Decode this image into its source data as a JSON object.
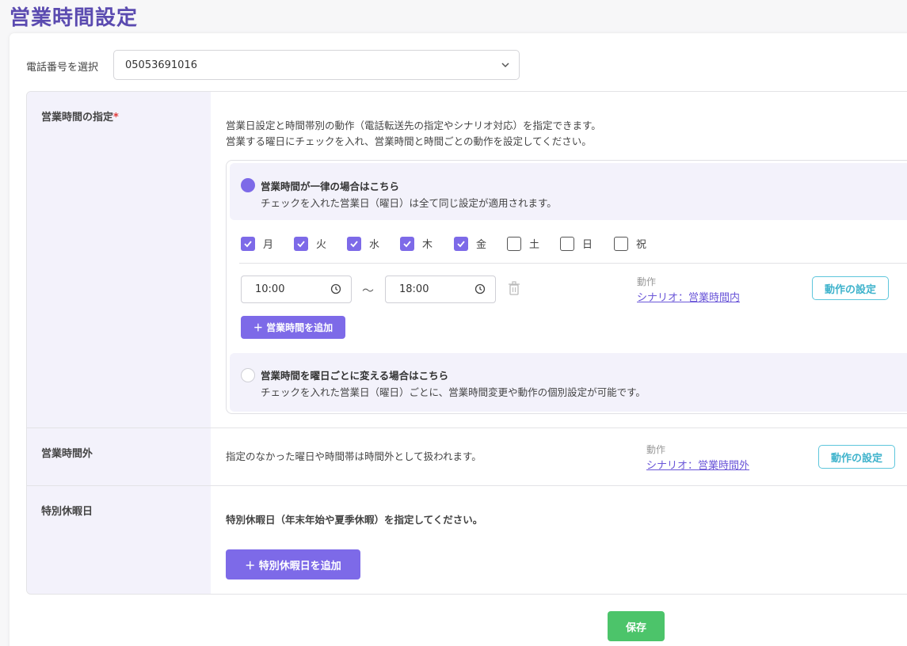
{
  "page_title": "営業時間設定",
  "phone": {
    "label": "電話番号を選択",
    "selected": "05053691016"
  },
  "business_hours": {
    "label": "営業時間の指定",
    "required_mark": "*",
    "description_line1": "営業日設定と時間帯別の動作（電話転送先の指定やシナリオ対応）を指定できます。",
    "description_line2": "営業する曜日にチェックを入れ、営業時間と時間ごとの動作を設定してください。",
    "uniform_option": {
      "title": "営業時間が一律の場合はこちら",
      "subtitle": "チェックを入れた営業日（曜日）は全て同じ設定が適用されます。",
      "selected": true
    },
    "days": [
      {
        "label": "月",
        "checked": true
      },
      {
        "label": "火",
        "checked": true
      },
      {
        "label": "水",
        "checked": true
      },
      {
        "label": "木",
        "checked": true
      },
      {
        "label": "金",
        "checked": true
      },
      {
        "label": "土",
        "checked": false
      },
      {
        "label": "日",
        "checked": false
      },
      {
        "label": "祝",
        "checked": false
      }
    ],
    "time_start": "10:00",
    "time_separator": "〜",
    "time_end": "18:00",
    "action_label": "動作",
    "action_value": "シナリオ：営業時間内",
    "action_button": "動作の設定",
    "add_time_button": "＋ 営業時間を追加",
    "per_day_option": {
      "title": "営業時間を曜日ごとに変える場合はこちら",
      "subtitle": "チェックを入れた営業日（曜日）ごとに、営業時間変更や動作の個別設定が可能です。",
      "selected": false
    }
  },
  "after_hours": {
    "label": "営業時間外",
    "description": "指定のなかった曜日や時間帯は時間外として扱われます。",
    "action_label": "動作",
    "action_value": "シナリオ：営業時間外",
    "action_button": "動作の設定"
  },
  "holidays": {
    "label": "特別休暇日",
    "description": "特別休暇日（年末年始や夏季休暇）を指定してください。",
    "add_button": "＋ 特別休暇日を追加"
  },
  "save_button": "保存",
  "colors": {
    "accent": "#7d6ae8",
    "title": "#5b4bb0",
    "save": "#4cc46a",
    "outline": "#5ec6dc"
  }
}
